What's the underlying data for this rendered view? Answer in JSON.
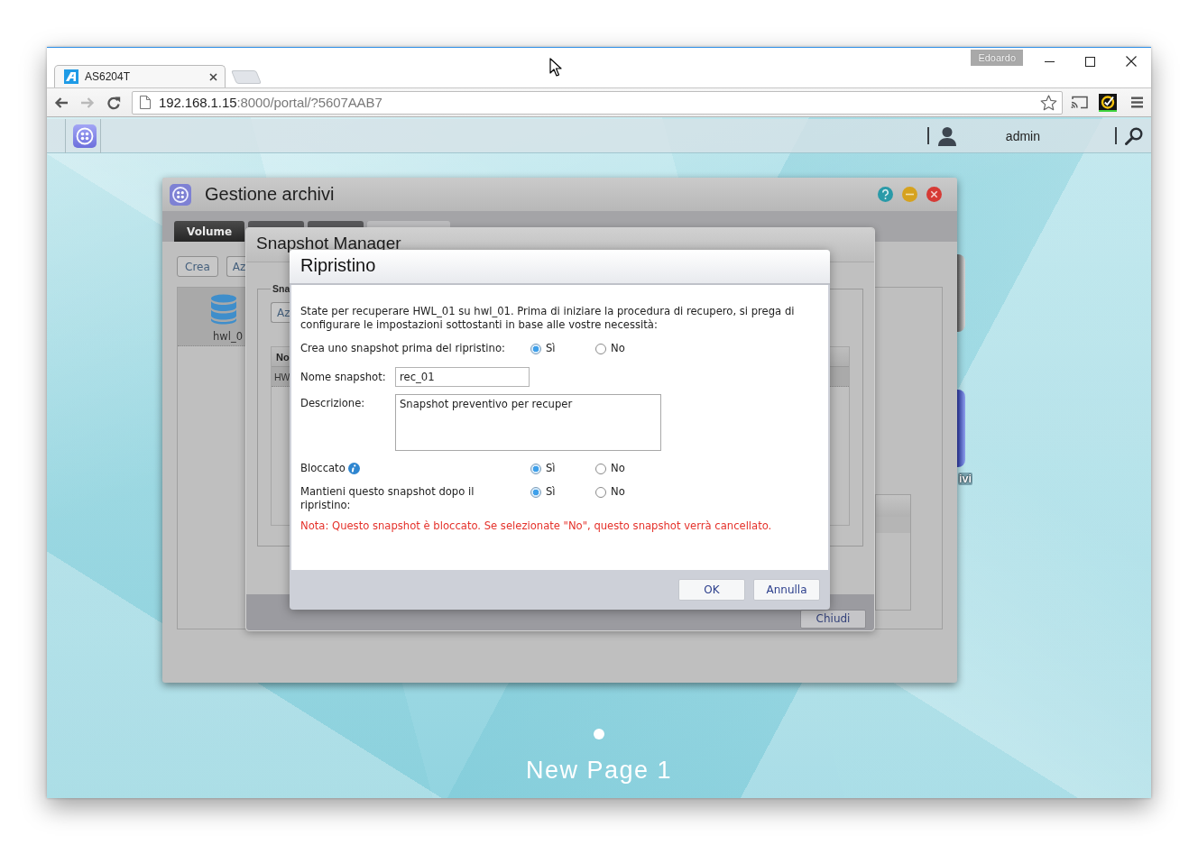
{
  "browser": {
    "tab": {
      "title": "AS6204T"
    },
    "profile": "Edoardo",
    "nav": [
      {
        "kind": "back",
        "disabled": false
      },
      {
        "kind": "forward",
        "disabled": true
      },
      {
        "kind": "reload",
        "disabled": false
      }
    ],
    "address": {
      "host": "192.168.1.15",
      "path": ":8000/portal/?5607AAB7"
    }
  },
  "app_bar": {
    "user": "admin"
  },
  "storage_window": {
    "title": "Gestione archivi",
    "tabs": [
      {
        "label": "Volume",
        "selected": true,
        "disabled": false
      },
      {
        "selected": false,
        "disabled": false
      },
      {
        "selected": false,
        "disabled": false
      },
      {
        "selected": false,
        "disabled": true
      }
    ],
    "toolbar": [
      "Crea",
      "Az"
    ],
    "volumes": [
      {
        "label": "hwl_0",
        "selected": true
      }
    ]
  },
  "snapshot_window": {
    "title": "Snapshot Manager",
    "legend": "Sna",
    "toolbar": [
      "Az"
    ],
    "table": {
      "columns": [
        "No"
      ],
      "rows": [
        {
          "cells": [
            "HW"
          ],
          "selected": true
        }
      ]
    },
    "footer_button": "Chiudi"
  },
  "dialog": {
    "title": "Ripristino",
    "intro": "State per recuperare HWL_01 su hwl_01. Prima di iniziare la procedura di recupero, si prega di configurare le impostazioni sottostanti in base alle vostre necessità:",
    "fields": [
      {
        "kind": "radio",
        "label": "Crea uno snapshot prima del ripristino:",
        "options": [
          {
            "label": "Sì",
            "selected": true
          },
          {
            "label": "No",
            "selected": false
          }
        ]
      },
      {
        "kind": "text",
        "label": "Nome snapshot:",
        "value": "rec_01"
      },
      {
        "kind": "textarea",
        "label": "Descrizione:",
        "value": "Snapshot preventivo per recuper"
      },
      {
        "kind": "radio",
        "label": "Bloccato",
        "info": true,
        "options": [
          {
            "label": "Sì",
            "selected": true
          },
          {
            "label": "No",
            "selected": false
          }
        ]
      },
      {
        "kind": "radio",
        "label": "Mantieni questo snapshot dopo il ripristino:",
        "options": [
          {
            "label": "Sì",
            "selected": true
          },
          {
            "label": "No",
            "selected": false
          }
        ]
      }
    ],
    "note": "Nota: Questo snapshot è bloccato. Se selezionate \"No\", questo snapshot verrà cancellato.",
    "buttons": [
      "OK",
      "Annulla"
    ]
  },
  "desktop": {
    "partial_label": "ivi",
    "pages": [
      {
        "selected": true
      }
    ],
    "page_title": "New Page 1"
  }
}
